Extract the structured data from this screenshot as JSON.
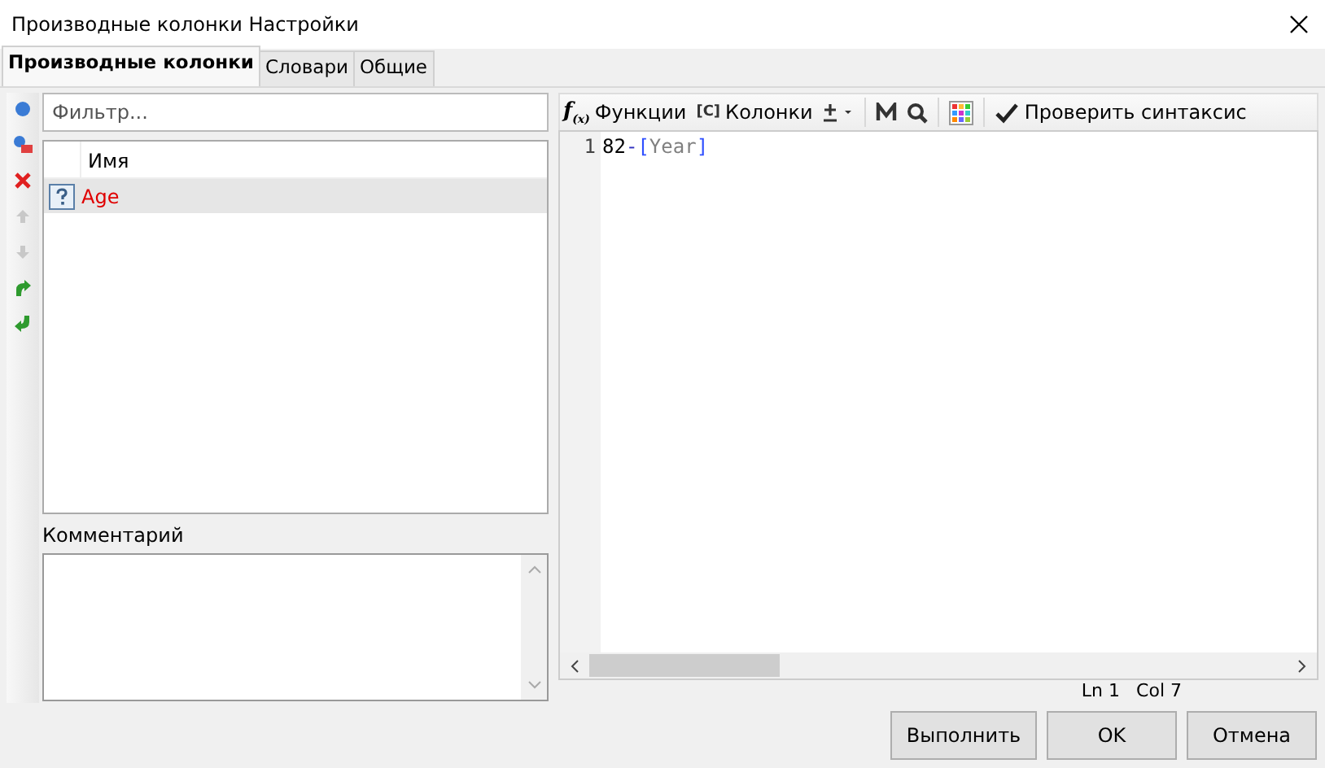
{
  "window": {
    "title": "Производные колонки Настройки"
  },
  "tabs": [
    {
      "label": "Производные колонки",
      "selected": true
    },
    {
      "label": "Словари",
      "selected": false
    },
    {
      "label": "Общие",
      "selected": false
    }
  ],
  "side_tools": [
    {
      "kind": "add",
      "disabled": false
    },
    {
      "kind": "add-multi",
      "disabled": false
    },
    {
      "kind": "delete",
      "disabled": false
    },
    {
      "kind": "up",
      "disabled": true
    },
    {
      "kind": "down",
      "disabled": true
    },
    {
      "kind": "import",
      "disabled": false
    },
    {
      "kind": "export",
      "disabled": false
    }
  ],
  "filter": {
    "placeholder": "Фильтр..."
  },
  "columns_list": {
    "header": "Имя",
    "rows": [
      {
        "name": "Age",
        "selected": true,
        "invalid": true
      }
    ]
  },
  "comment": {
    "label": "Комментарий"
  },
  "toolbar": [
    {
      "kind": "functions",
      "icon_text": "f$_{(x)}$",
      "label": "Функции"
    },
    {
      "kind": "columns",
      "icon_text": "[C]",
      "label": "Колонки"
    },
    {
      "kind": "operators"
    },
    {
      "kind": "sep"
    },
    {
      "kind": "bold-m"
    },
    {
      "kind": "zoom"
    },
    {
      "kind": "sep"
    },
    {
      "kind": "palette"
    },
    {
      "kind": "sep"
    },
    {
      "kind": "check",
      "label": "Проверить синтаксис"
    }
  ],
  "editor": {
    "lines": [
      {
        "number": "1",
        "tokens": [
          {
            "kind": "number",
            "text": "82"
          },
          {
            "kind": "operator",
            "text": "-"
          },
          {
            "kind": "bracket",
            "text": "["
          },
          {
            "kind": "column",
            "text": "Year"
          },
          {
            "kind": "bracket",
            "text": "]"
          }
        ]
      }
    ]
  },
  "status": {
    "line": "Ln 1",
    "col": "Col 7"
  },
  "buttons": [
    {
      "label": "Выполнить"
    },
    {
      "label": "OK"
    },
    {
      "label": "Отмена"
    }
  ]
}
